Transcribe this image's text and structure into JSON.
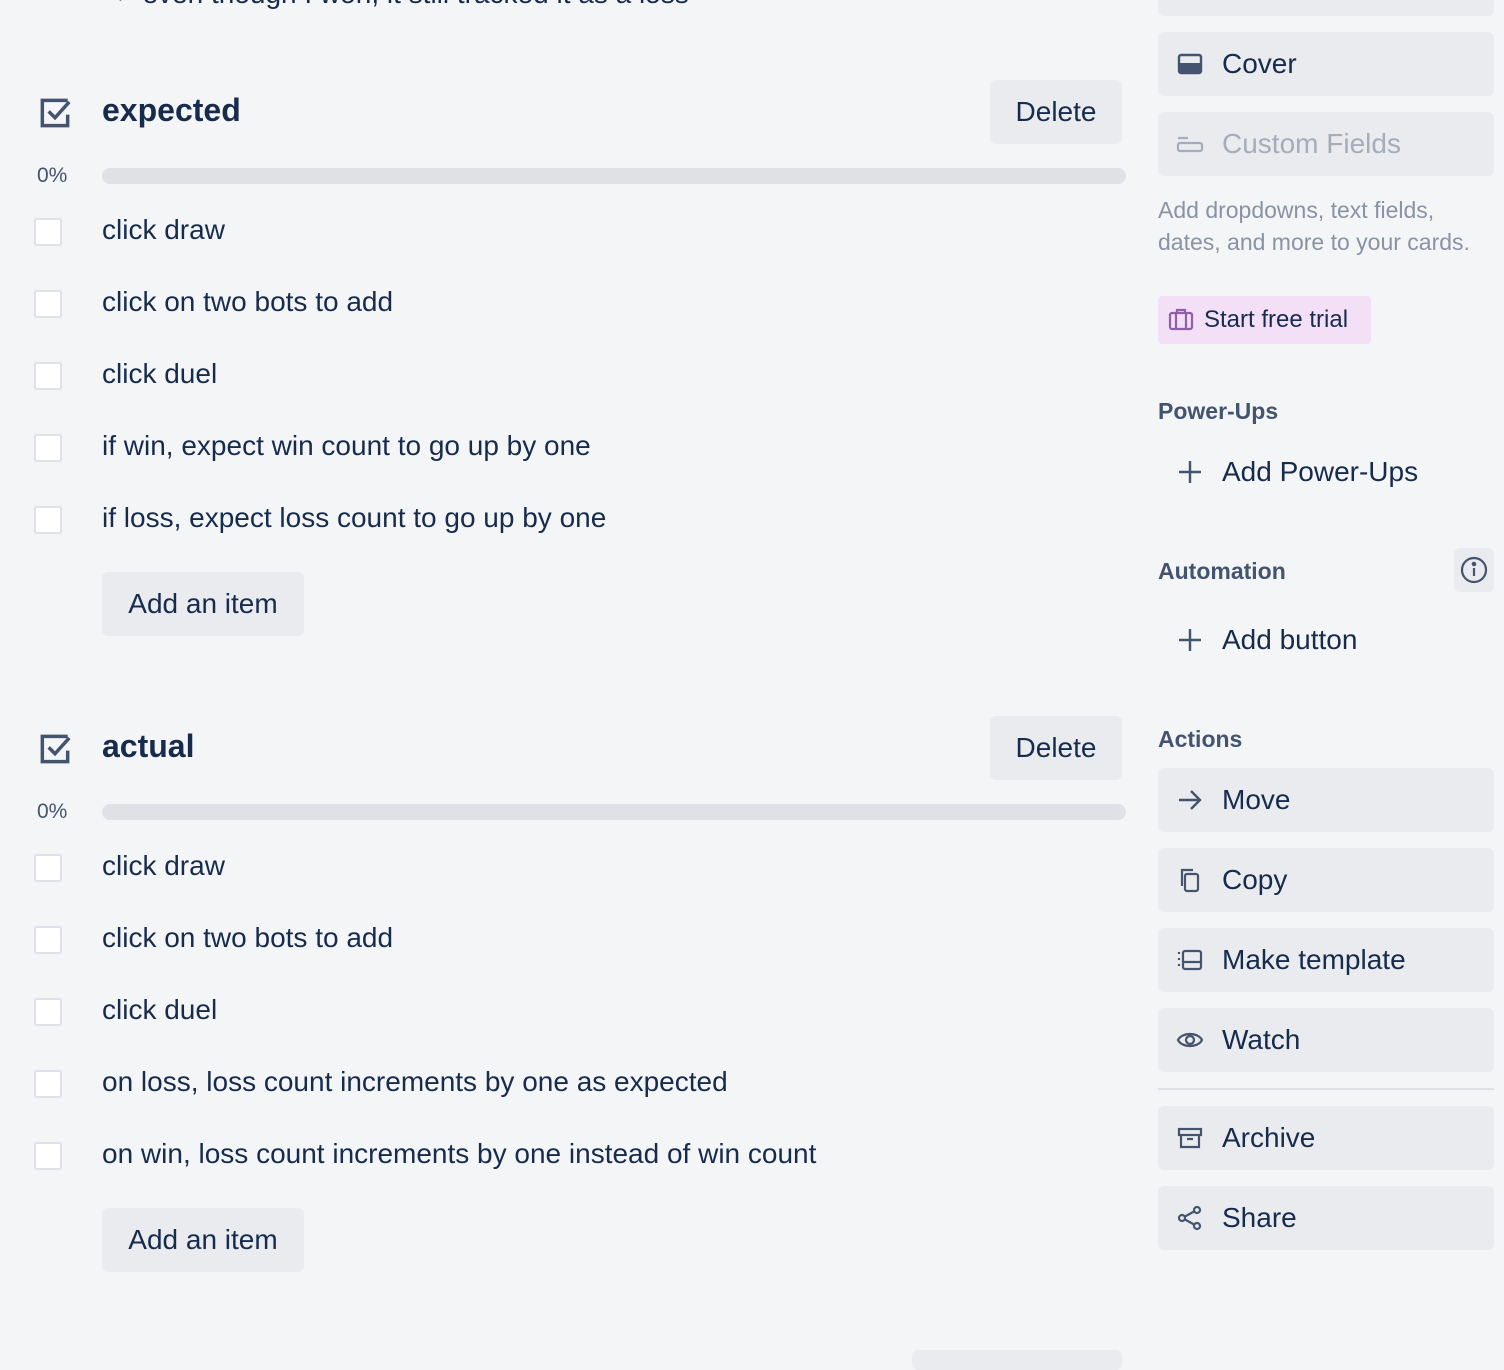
{
  "prev_text": "=> even though I won, it still tracked it as a loss",
  "checklists": [
    {
      "title": "expected",
      "delete_label": "Delete",
      "percent": "0%",
      "progress_value": 0,
      "items": [
        {
          "text": "click draw",
          "checked": false
        },
        {
          "text": "click on two bots to add",
          "checked": false
        },
        {
          "text": "click duel",
          "checked": false
        },
        {
          "text": "if win, expect win count to go up by one",
          "checked": false
        },
        {
          "text": "if loss, expect loss count to go up by one",
          "checked": false
        }
      ],
      "add_item_label": "Add an item"
    },
    {
      "title": "actual",
      "delete_label": "Delete",
      "percent": "0%",
      "progress_value": 0,
      "items": [
        {
          "text": "click draw",
          "checked": false
        },
        {
          "text": "click on two bots to add",
          "checked": false
        },
        {
          "text": "click duel",
          "checked": false
        },
        {
          "text": "on loss, loss count increments by one as expected",
          "checked": false
        },
        {
          "text": "on win, loss count increments by one instead of win count",
          "checked": false
        }
      ],
      "add_item_label": "Add an item"
    }
  ],
  "sidebar": {
    "cover_label": "Cover",
    "custom_fields_label": "Custom Fields",
    "custom_fields_desc": "Add dropdowns, text fields, dates, and more to your cards.",
    "trial_label": "Start free trial",
    "powerups_heading": "Power-Ups",
    "add_powerups_label": "Add Power-Ups",
    "automation_heading": "Automation",
    "add_button_label": "Add button",
    "actions_heading": "Actions",
    "actions": {
      "move": "Move",
      "copy": "Copy",
      "make_template": "Make template",
      "watch": "Watch",
      "archive": "Archive",
      "share": "Share"
    }
  },
  "colors": {
    "background": "#f4f5f7",
    "text": "#172b4d",
    "button_bg": "#e9ebee",
    "trial_bg": "#f3e0f7",
    "progress_track": "#dfe1e6"
  }
}
